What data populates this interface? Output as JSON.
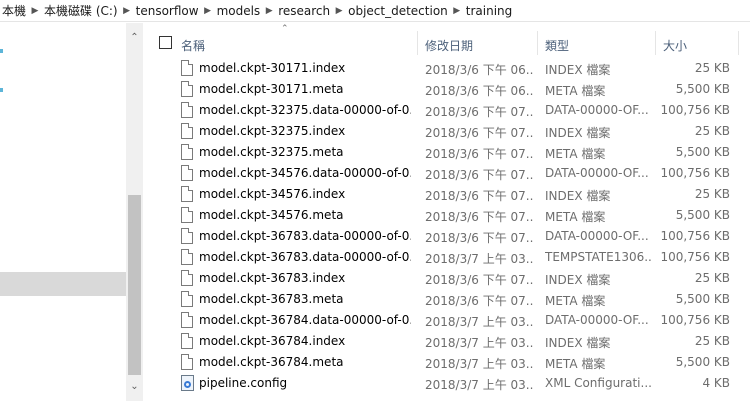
{
  "breadcrumb": [
    "本機",
    "本機磁碟 (C:)",
    "tensorflow",
    "models",
    "research",
    "object_detection",
    "training"
  ],
  "columns": {
    "name": "名稱",
    "date": "修改日期",
    "type": "類型",
    "size": "大小"
  },
  "files": [
    {
      "name": "model.ckpt-30171.index",
      "date": "2018/3/6 下午 06...",
      "type": "INDEX 檔案",
      "size": "25 KB",
      "icon": "file-icon"
    },
    {
      "name": "model.ckpt-30171.meta",
      "date": "2018/3/6 下午 06...",
      "type": "META 檔案",
      "size": "5,500 KB",
      "icon": "file-icon"
    },
    {
      "name": "model.ckpt-32375.data-00000-of-0...",
      "date": "2018/3/6 下午 07...",
      "type": "DATA-00000-OF...",
      "size": "100,756 KB",
      "icon": "file-icon"
    },
    {
      "name": "model.ckpt-32375.index",
      "date": "2018/3/6 下午 07...",
      "type": "INDEX 檔案",
      "size": "25 KB",
      "icon": "file-icon"
    },
    {
      "name": "model.ckpt-32375.meta",
      "date": "2018/3/6 下午 07...",
      "type": "META 檔案",
      "size": "5,500 KB",
      "icon": "file-icon"
    },
    {
      "name": "model.ckpt-34576.data-00000-of-0...",
      "date": "2018/3/6 下午 07...",
      "type": "DATA-00000-OF...",
      "size": "100,756 KB",
      "icon": "file-icon"
    },
    {
      "name": "model.ckpt-34576.index",
      "date": "2018/3/6 下午 07...",
      "type": "INDEX 檔案",
      "size": "25 KB",
      "icon": "file-icon"
    },
    {
      "name": "model.ckpt-34576.meta",
      "date": "2018/3/6 下午 07...",
      "type": "META 檔案",
      "size": "5,500 KB",
      "icon": "file-icon"
    },
    {
      "name": "model.ckpt-36783.data-00000-of-0...",
      "date": "2018/3/6 下午 07...",
      "type": "DATA-00000-OF...",
      "size": "100,756 KB",
      "icon": "file-icon"
    },
    {
      "name": "model.ckpt-36783.data-00000-of-0...",
      "date": "2018/3/7 上午 03...",
      "type": "TEMPSTATE1306...",
      "size": "100,756 KB",
      "icon": "file-icon"
    },
    {
      "name": "model.ckpt-36783.index",
      "date": "2018/3/6 下午 07...",
      "type": "INDEX 檔案",
      "size": "25 KB",
      "icon": "file-icon"
    },
    {
      "name": "model.ckpt-36783.meta",
      "date": "2018/3/6 下午 07...",
      "type": "META 檔案",
      "size": "5,500 KB",
      "icon": "file-icon"
    },
    {
      "name": "model.ckpt-36784.data-00000-of-0...",
      "date": "2018/3/7 上午 03...",
      "type": "DATA-00000-OF...",
      "size": "100,756 KB",
      "icon": "file-icon"
    },
    {
      "name": "model.ckpt-36784.index",
      "date": "2018/3/7 上午 03...",
      "type": "INDEX 檔案",
      "size": "25 KB",
      "icon": "file-icon"
    },
    {
      "name": "model.ckpt-36784.meta",
      "date": "2018/3/7 上午 03...",
      "type": "META 檔案",
      "size": "5,500 KB",
      "icon": "file-icon"
    },
    {
      "name": "pipeline.config",
      "date": "2018/3/7 上午 03...",
      "type": "XML Configurati...",
      "size": "4 KB",
      "icon": "config-file-icon"
    }
  ]
}
